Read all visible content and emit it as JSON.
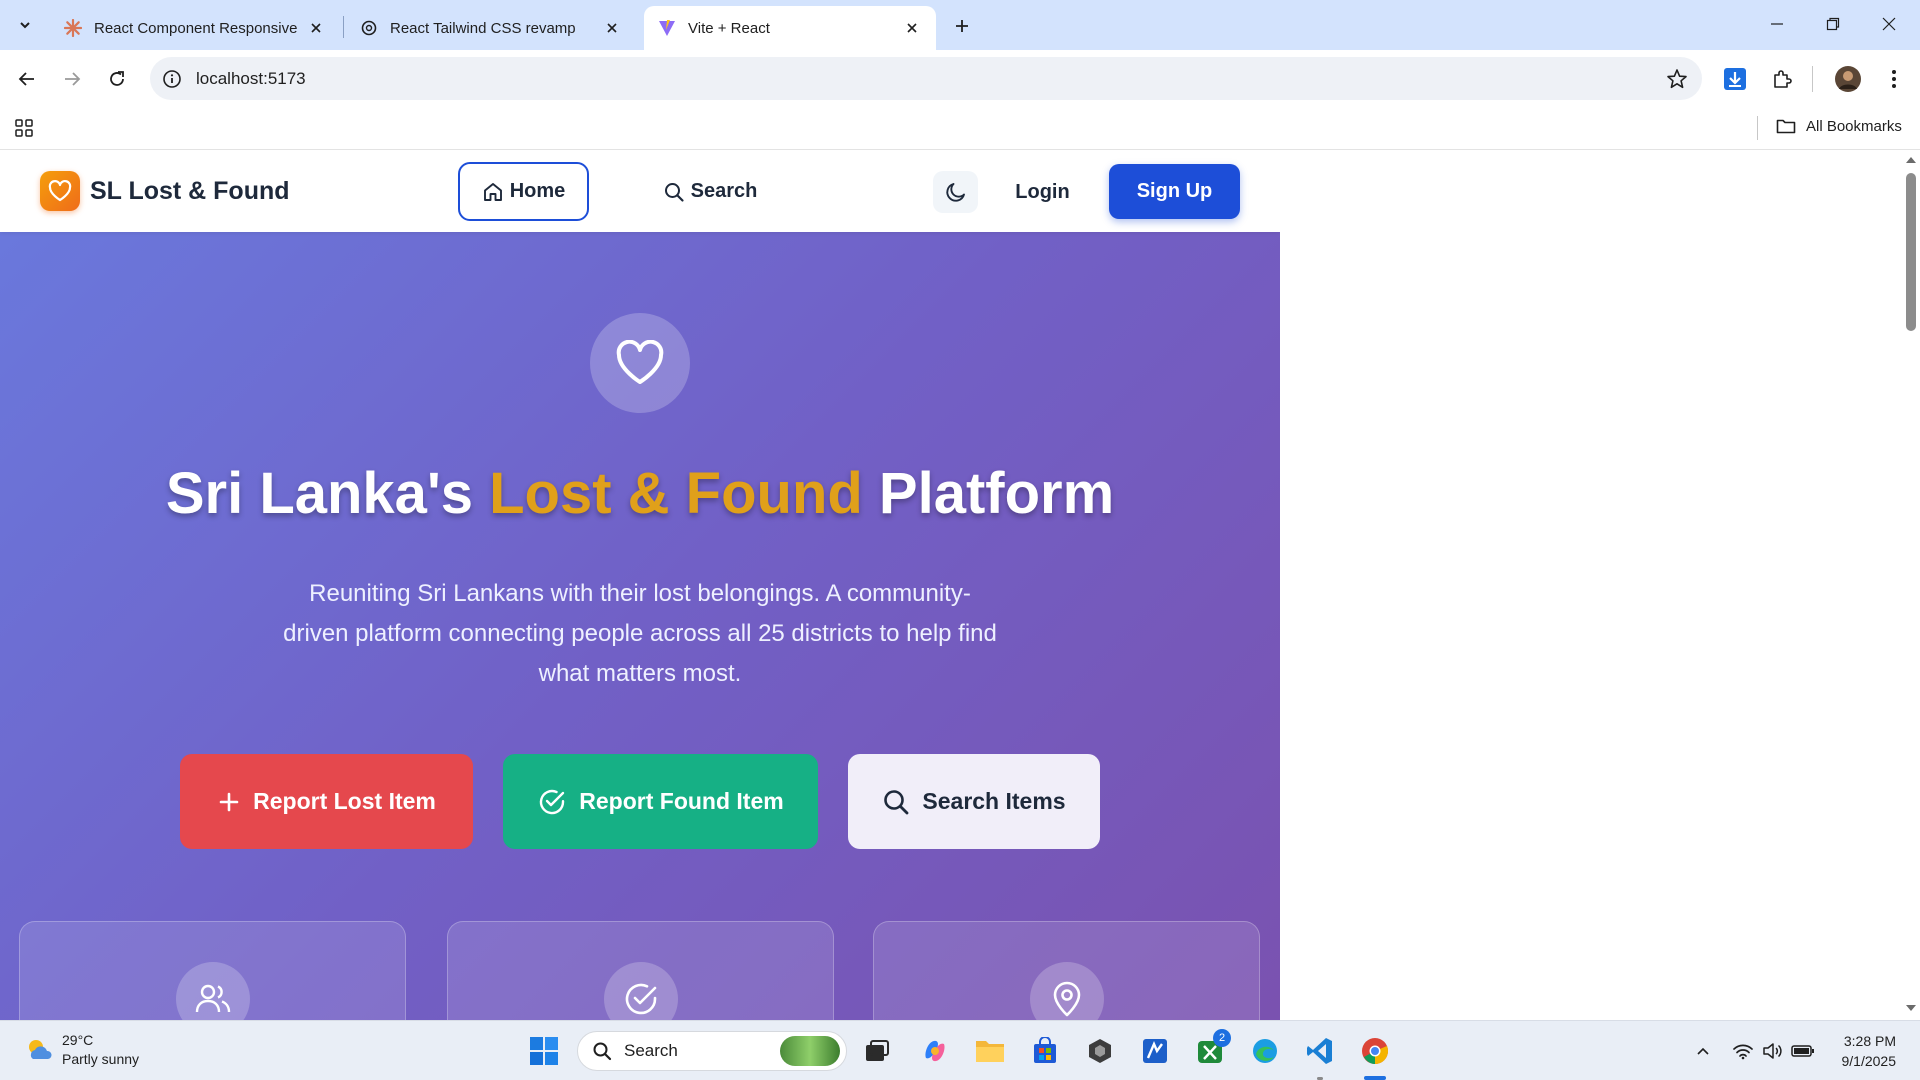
{
  "browser": {
    "tabs": [
      {
        "title": "React Component Responsive R",
        "favicon": "claude-icon"
      },
      {
        "title": "React Tailwind CSS revamp",
        "favicon": "chatgpt-icon"
      },
      {
        "title": "Vite + React",
        "favicon": "vite-icon",
        "active": true
      }
    ],
    "url": "localhost:5173",
    "bookmarks_label": "All Bookmarks"
  },
  "site": {
    "brand": "SL Lost & Found",
    "nav": {
      "home": "Home",
      "search": "Search",
      "login": "Login",
      "signup": "Sign Up"
    },
    "hero": {
      "title_part1": "Sri Lanka's ",
      "title_highlight": "Lost & Found",
      "title_part2": " Platform",
      "subtitle": "Reuniting Sri Lankans with their lost belongings. A community-driven platform connecting people across all 25 districts to help find what matters most.",
      "buttons": {
        "report_lost": "Report Lost Item",
        "report_found": "Report Found Item",
        "search": "Search Items"
      }
    },
    "colors": {
      "primary": "#1d4ed8",
      "accent_highlight": "#e0a01a",
      "lost_red": "#e5484d",
      "found_green": "#16b085",
      "hero_gradient_start": "#6a78dc",
      "hero_gradient_end": "#7a52b0"
    }
  },
  "taskbar": {
    "weather_temp": "29°C",
    "weather_desc": "Partly sunny",
    "search_placeholder": "Search",
    "xbox_badge": "2",
    "time": "3:28 PM",
    "date": "9/1/2025"
  }
}
